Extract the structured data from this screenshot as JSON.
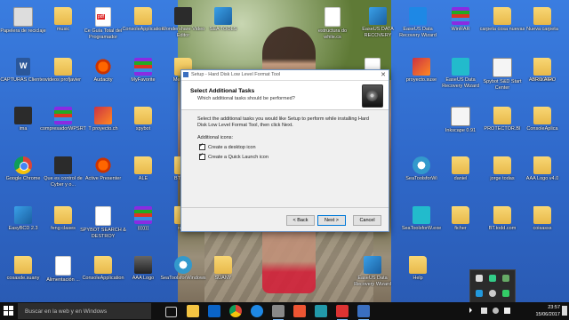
{
  "desktop": {
    "icons": [
      {
        "label": "Papelera de reciclaje",
        "type": "wiz"
      },
      {
        "label": "music",
        "type": "folder"
      },
      {
        "label": "Ce Guía Total del Programador",
        "type": "pdf"
      },
      {
        "label": "ConsoleApplication",
        "type": "folder"
      },
      {
        "label": "Wondershare Video Editor",
        "type": "dark"
      },
      {
        "label": "SEA TOOLS",
        "type": "setup"
      },
      {
        "label": "estructura do while.cs",
        "type": "doc"
      },
      {
        "label": "EaseUS DATA RECOVERY",
        "type": "setup"
      },
      {
        "label": "EaseUS Data Recovery Wizard",
        "type": "blue"
      },
      {
        "label": "WinRAR",
        "type": "rar"
      },
      {
        "label": "carpeta cosa nuevas",
        "type": "folder"
      },
      {
        "label": "Nueva carpeta",
        "type": "folder"
      },
      {
        "label": "CAPTURAS Clientes",
        "type": "word"
      },
      {
        "label": "videos profjavier",
        "type": "folder"
      },
      {
        "label": "Audacity",
        "type": "audacity"
      },
      {
        "label": "MyFavorite",
        "type": "rar"
      },
      {
        "label": "MemTest",
        "type": "folder"
      },
      {
        "label": "...MAS",
        "type": "doc"
      },
      {
        "label": "proyecto.suse",
        "type": "photo"
      },
      {
        "label": "EaseUS Data Recovery Wizard",
        "type": "cyan"
      },
      {
        "label": "Spybot S&D Start Center",
        "type": "spider"
      },
      {
        "label": "PROGRA",
        "type": "folder"
      },
      {
        "label": "ABRIL AIRO",
        "type": "folder"
      },
      {
        "label": "ima",
        "type": "dark"
      },
      {
        "label": "compresadorWPSRT",
        "type": "rar"
      },
      {
        "label": "T proyecto.ch",
        "type": "photo"
      },
      {
        "label": "spybot",
        "type": "folder"
      },
      {
        "label": "Inkscape 0.91",
        "type": "spider"
      },
      {
        "label": "PROTECTOR.BI",
        "type": "folder"
      },
      {
        "label": "ConsoleAplica",
        "type": "folder"
      },
      {
        "label": "Google Chrome",
        "type": "chrome"
      },
      {
        "label": "Que es control de Cyber y o...",
        "type": "dark"
      },
      {
        "label": "Active Presenter",
        "type": "audacity"
      },
      {
        "label": "ALE",
        "type": "folder"
      },
      {
        "label": "BT tools",
        "type": "folder"
      },
      {
        "label": "SeaToolsforWi",
        "type": "sea"
      },
      {
        "label": "daniel",
        "type": "folder"
      },
      {
        "label": "jorge todas",
        "type": "folder"
      },
      {
        "label": "AAA Logo v4.0",
        "type": "folder"
      },
      {
        "label": "EasyBCD 2.3",
        "type": "setup"
      },
      {
        "label": "feng clases",
        "type": "folder"
      },
      {
        "label": "SPYBOT SEARCH & DESTROY",
        "type": "doc"
      },
      {
        "label": "(((((((",
        "type": "rar"
      },
      {
        "label": "reine",
        "type": "folder"
      },
      {
        "label": "SeaToolsforW.exe",
        "type": "cyan"
      },
      {
        "label": "ficher",
        "type": "folder"
      },
      {
        "label": "BT.todd.com",
        "type": "folder"
      },
      {
        "label": "coisasss",
        "type": "folder"
      },
      {
        "label": "cosasde.suany",
        "type": "folder"
      },
      {
        "label": "Alimentación ...",
        "type": "doc"
      },
      {
        "label": "ConsoleApplication",
        "type": "folder"
      },
      {
        "label": "AAA Logo",
        "type": "disk"
      },
      {
        "label": "SeaToolsforWindows",
        "type": "sea"
      },
      {
        "label": "SUANY",
        "type": "folder"
      },
      {
        "label": "EaseUS Data Recovery Wizard",
        "type": "setup"
      },
      {
        "label": "Help",
        "type": "folder"
      }
    ]
  },
  "dialog": {
    "title": "Setup - Hard Disk Low Level Format Tool",
    "close_label": "✕",
    "heading": "Select Additional Tasks",
    "subheading": "Which additional tasks should be performed?",
    "description": "Select the additional tasks you would like Setup to perform while installing Hard Disk Low Level Format Tool, then click Next.",
    "additional_icons_label": "Additional icons:",
    "checkboxes": [
      {
        "label": "Create a desktop icon",
        "checked": true
      },
      {
        "label": "Create a Quick Launch icon",
        "checked": true
      }
    ],
    "back_label": "< Back",
    "next_label": "Next >",
    "cancel_label": "Cancel"
  },
  "taskbar": {
    "search_placeholder": "Buscar en la web y en Windows",
    "time": "23:57",
    "date": "15/06/2017"
  }
}
